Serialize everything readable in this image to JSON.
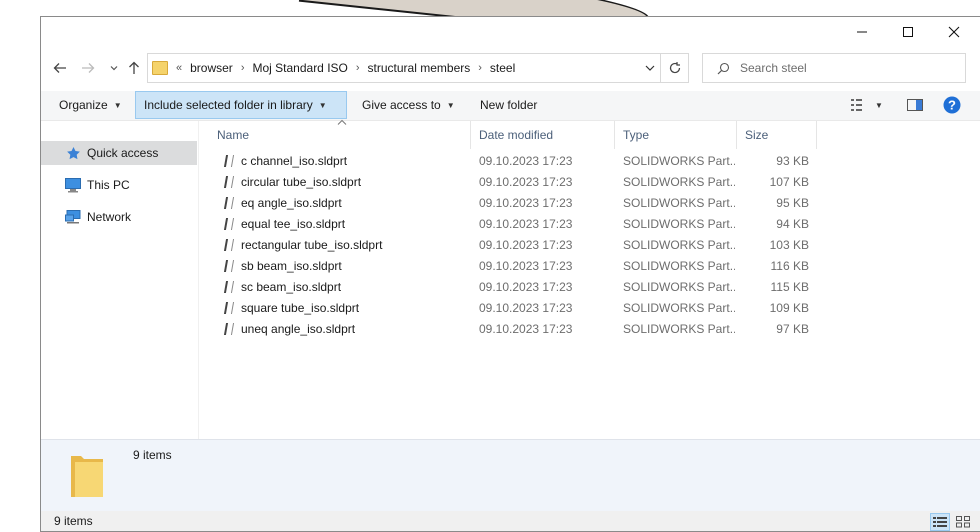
{
  "window": {
    "controls": {
      "minimize": "minimize-icon",
      "maximize": "maximize-icon",
      "close": "close-icon"
    }
  },
  "address": {
    "overflow": "«",
    "breadcrumbs": [
      "browser",
      "Moj Standard ISO",
      "structural members",
      "steel"
    ]
  },
  "search": {
    "placeholder": "Search steel"
  },
  "toolbar": {
    "organize": "Organize",
    "include_library": "Include selected folder in library",
    "give_access": "Give access to",
    "new_folder": "New folder"
  },
  "sidebar": {
    "items": [
      {
        "label": "Quick access",
        "icon": "star-icon"
      },
      {
        "label": "This PC",
        "icon": "computer-icon"
      },
      {
        "label": "Network",
        "icon": "network-icon"
      }
    ]
  },
  "columns": {
    "name": "Name",
    "date": "Date modified",
    "type": "Type",
    "size": "Size"
  },
  "files": [
    {
      "name": "c channel_iso.sldprt",
      "date": "09.10.2023 17:23",
      "type": "SOLIDWORKS Part...",
      "size": "93 KB"
    },
    {
      "name": "circular tube_iso.sldprt",
      "date": "09.10.2023 17:23",
      "type": "SOLIDWORKS Part...",
      "size": "107 KB"
    },
    {
      "name": "eq angle_iso.sldprt",
      "date": "09.10.2023 17:23",
      "type": "SOLIDWORKS Part...",
      "size": "95 KB"
    },
    {
      "name": "equal tee_iso.sldprt",
      "date": "09.10.2023 17:23",
      "type": "SOLIDWORKS Part...",
      "size": "94 KB"
    },
    {
      "name": "rectangular tube_iso.sldprt",
      "date": "09.10.2023 17:23",
      "type": "SOLIDWORKS Part...",
      "size": "103 KB"
    },
    {
      "name": "sb beam_iso.sldprt",
      "date": "09.10.2023 17:23",
      "type": "SOLIDWORKS Part...",
      "size": "116 KB"
    },
    {
      "name": "sc beam_iso.sldprt",
      "date": "09.10.2023 17:23",
      "type": "SOLIDWORKS Part...",
      "size": "115 KB"
    },
    {
      "name": "square tube_iso.sldprt",
      "date": "09.10.2023 17:23",
      "type": "SOLIDWORKS Part...",
      "size": "109 KB"
    },
    {
      "name": "uneq angle_iso.sldprt",
      "date": "09.10.2023 17:23",
      "type": "SOLIDWORKS Part...",
      "size": "97 KB"
    }
  ],
  "details": {
    "count": "9 items"
  },
  "status": {
    "count": "9 items"
  },
  "colors": {
    "accent": "#cce4f7",
    "accent_border": "#99c9ef",
    "help": "#1f6fd6",
    "folder": "#f5d36b"
  }
}
